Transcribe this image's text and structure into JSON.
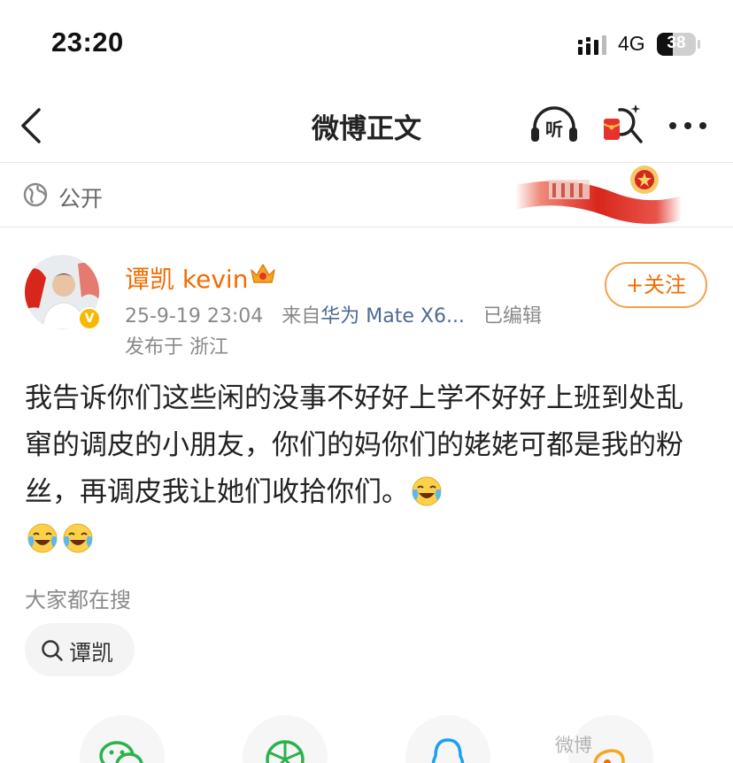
{
  "status_bar": {
    "time": "23:20",
    "network": "4G",
    "battery": "38"
  },
  "nav": {
    "title": "微博正文",
    "listen_label": "听"
  },
  "visibility": {
    "label": "公开"
  },
  "author": {
    "name": "谭凯 kevin",
    "verified_badge": "V",
    "follow_label": "+关注",
    "timestamp": "25-9-19 23:04",
    "source_prefix": "来自",
    "device": "华为 Mate X6...",
    "edited": "已编辑",
    "location": "发布于 浙江"
  },
  "post": {
    "text": "我告诉你们这些闲的没事不好好上学不好好上班到处乱窜的调皮的小朋友，你们的妈你们的姥姥可都是我的粉丝，再调皮我让她们收拾你们。",
    "emoji_count": 3,
    "emoji_icon": "laughing-crying-emoji"
  },
  "search": {
    "header": "大家都在搜",
    "chips": [
      {
        "label": "谭凯",
        "icon": "search-icon"
      }
    ]
  },
  "share": {
    "icons": [
      "wechat-icon",
      "moments-icon",
      "qq-icon",
      "weibo-icon"
    ]
  },
  "watermark": "微博"
}
